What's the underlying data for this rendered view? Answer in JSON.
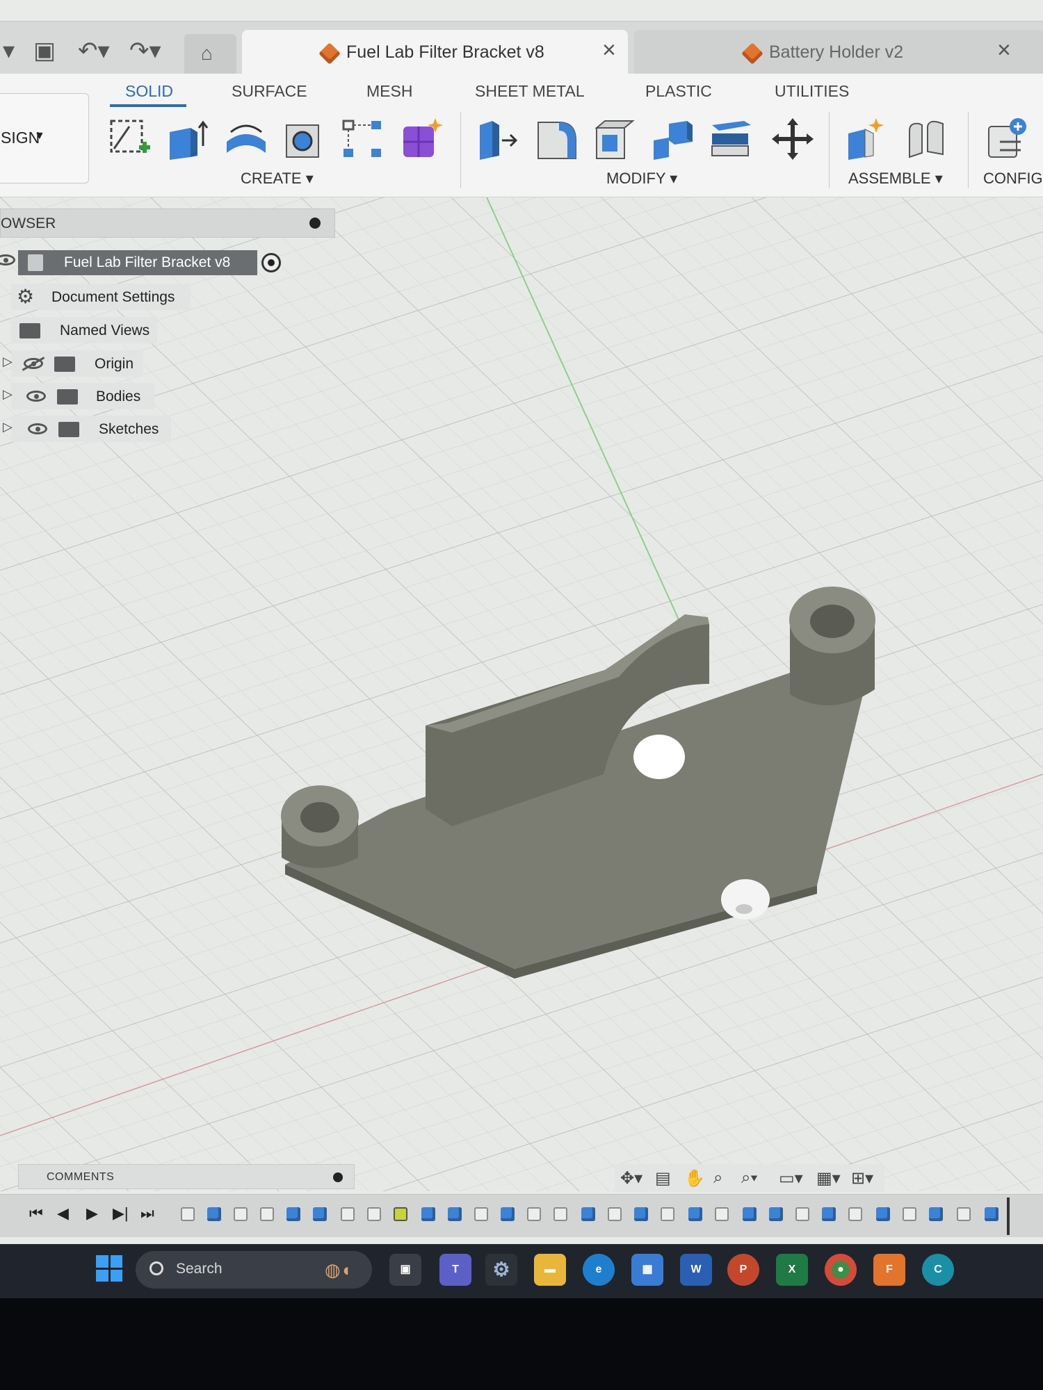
{
  "tabs": {
    "active": {
      "title": "Fuel Lab Filter Bracket v8"
    },
    "inactive": {
      "title": "Battery Holder v2"
    }
  },
  "ribbon": {
    "workspace_button": "SIGN",
    "workspace_tabs": [
      "SOLID",
      "SURFACE",
      "MESH",
      "SHEET METAL",
      "PLASTIC",
      "UTILITIES"
    ],
    "groups": {
      "create": "CREATE",
      "modify": "MODIFY",
      "assemble": "ASSEMBLE",
      "config": "CONFIG"
    }
  },
  "browser": {
    "header": "OWSER",
    "root": "Fuel Lab Filter Bracket v8",
    "items": [
      "Document Settings",
      "Named Views",
      "Origin",
      "Bodies",
      "Sketches"
    ]
  },
  "comments": {
    "label": "COMMENTS"
  },
  "taskbar": {
    "search_placeholder": "Search"
  },
  "colors": {
    "accent": "#2b6cb0",
    "model": "#7a7c70",
    "brand_orange": "#e2742b"
  }
}
